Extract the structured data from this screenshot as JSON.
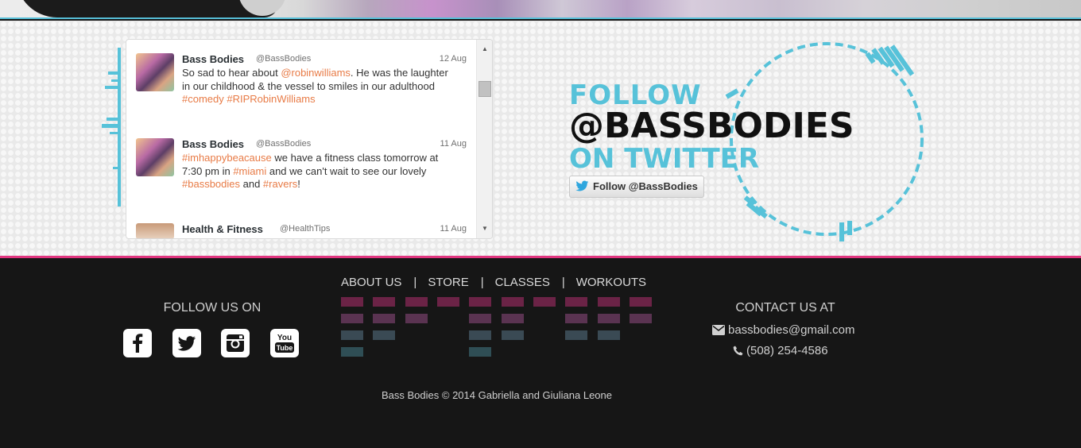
{
  "twitter_widget": {
    "tweets": [
      {
        "name": "Bass Bodies",
        "handle": "@BassBodies",
        "date": "12 Aug",
        "segments": [
          {
            "t": "So sad to hear about "
          },
          {
            "t": "@robinwilliams",
            "link": true
          },
          {
            "t": ". He was the laughter in our childhood & the vessel to smiles in our adulthood "
          },
          {
            "t": "#comedy",
            "link": true
          },
          {
            "t": " "
          },
          {
            "t": "#RIPRobinWilliams",
            "link": true
          }
        ]
      },
      {
        "name": "Bass Bodies",
        "handle": "@BassBodies",
        "date": "11 Aug",
        "segments": [
          {
            "t": "#imhappybeacause",
            "link": true
          },
          {
            "t": " we have a fitness class tomorrow at 7:30 pm in "
          },
          {
            "t": "#miami",
            "link": true
          },
          {
            "t": " and we can't wait to see our lovely "
          },
          {
            "t": "#bassbodies",
            "link": true
          },
          {
            "t": " and "
          },
          {
            "t": "#ravers",
            "link": true
          },
          {
            "t": "!"
          }
        ]
      },
      {
        "name": "Health & Fitness",
        "handle": "@HealthTips",
        "date": "11 Aug",
        "segments": []
      }
    ]
  },
  "follow_block": {
    "line1": "FOLLOW",
    "line2": "@BASSBODIES",
    "line3": "ON TWITTER",
    "button_label": "Follow @BassBodies"
  },
  "footer": {
    "follow_us_title": "FOLLOW US ON",
    "social": [
      "facebook-icon",
      "twitter-icon",
      "instagram-icon",
      "youtube-icon"
    ],
    "nav": [
      "ABOUT US",
      "STORE",
      "CLASSES",
      "WORKOUTS"
    ],
    "nav_separator": "|",
    "contact_title": "CONTACT US AT",
    "email": "bassbodies@gmail.com",
    "phone": "(508) 254-4586",
    "copyright": "Bass Bodies © 2014 Gabriella and Giuliana Leone"
  },
  "colors": {
    "accent_cyan": "#57c2d9",
    "accent_pink": "#e0357f",
    "link_orange": "#e87b46",
    "footer_bg": "#161616"
  }
}
